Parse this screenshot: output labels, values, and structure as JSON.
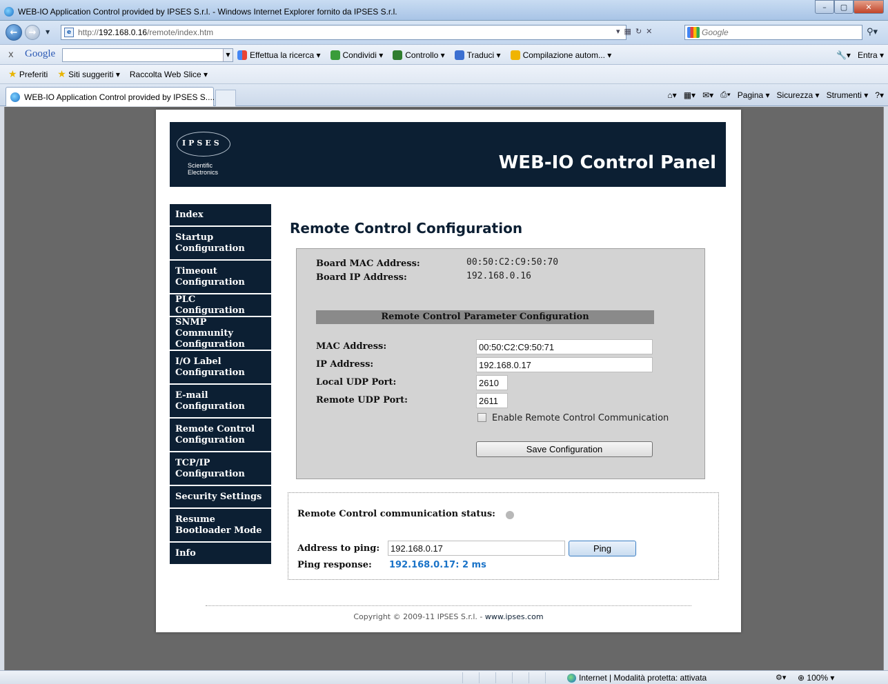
{
  "browser": {
    "window_title": "WEB-IO Application Control provided by IPSES S.r.l. - Windows Internet Explorer fornito da IPSES S.r.l.",
    "url_prefix": "http://",
    "url_host": "192.168.0.16",
    "url_path": "/remote/index.htm",
    "search_placeholder": "Google",
    "google_bar": {
      "logo": "Google",
      "items": [
        "Effettua la ricerca ▾",
        "Condividi ▾",
        "Controllo ▾",
        "Traduci ▾",
        "Compilazione autom... ▾"
      ],
      "signin": "Entra ▾"
    },
    "favorites": {
      "label": "Preferiti",
      "items": [
        "Siti suggeriti ▾",
        "Raccolta Web Slice ▾"
      ]
    },
    "tab_title": "WEB-IO Application Control provided by IPSES S....",
    "command_bar": [
      "Pagina ▾",
      "Sicurezza ▾",
      "Strumenti ▾"
    ],
    "status_zone": "Internet | Modalità protetta: attivata",
    "zoom": "100%"
  },
  "banner": {
    "logo_text": "IPSES",
    "logo_sub_1": "Scientific",
    "logo_sub_2": "Electronics",
    "title": "WEB-IO Control Panel"
  },
  "nav": {
    "items": [
      {
        "line1": "Index",
        "line2": ""
      },
      {
        "line1": "Startup",
        "line2": "Configuration"
      },
      {
        "line1": "Timeout",
        "line2": "Configuration"
      },
      {
        "line1": "PLC Configuration",
        "line2": ""
      },
      {
        "line1": "SNMP Community",
        "line2": "Configuration"
      },
      {
        "line1": "I/O Label",
        "line2": "Configuration"
      },
      {
        "line1": "E-mail",
        "line2": "Configuration"
      },
      {
        "line1": "Remote Control",
        "line2": "Configuration"
      },
      {
        "line1": "TCP/IP",
        "line2": "Configuration"
      },
      {
        "line1": "Security Settings",
        "line2": ""
      },
      {
        "line1": "Resume",
        "line2": "Bootloader Mode"
      },
      {
        "line1": "Info",
        "line2": ""
      }
    ]
  },
  "main": {
    "title": "Remote Control Configuration",
    "board_mac_label": "Board MAC Address:",
    "board_mac_value": "00:50:C2:C9:50:70",
    "board_ip_label": "Board IP Address:",
    "board_ip_value": "192.168.0.16",
    "section_title": "Remote Control Parameter Configuration",
    "mac_label": "MAC Address:",
    "mac_value": "00:50:C2:C9:50:71",
    "ip_label": "IP Address:",
    "ip_value": "192.168.0.17",
    "local_port_label": "Local UDP Port:",
    "local_port_value": "2610",
    "remote_port_label": "Remote UDP Port:",
    "remote_port_value": "2611",
    "enable_label": "Enable Remote Control Communication",
    "enable_checked": false,
    "save_label": "Save Configuration"
  },
  "status": {
    "comm_label": "Remote Control communication status:",
    "led_color": "#b8b8b8",
    "ping_label": "Address to ping:",
    "ping_value": "192.168.0.17",
    "ping_button": "Ping",
    "response_label": "Ping response:",
    "response_value": "192.168.0.17: 2 ms"
  },
  "footer": {
    "copyright": "Copyright © 2009-11 IPSES S.r.l. - ",
    "link": "www.ipses.com"
  }
}
